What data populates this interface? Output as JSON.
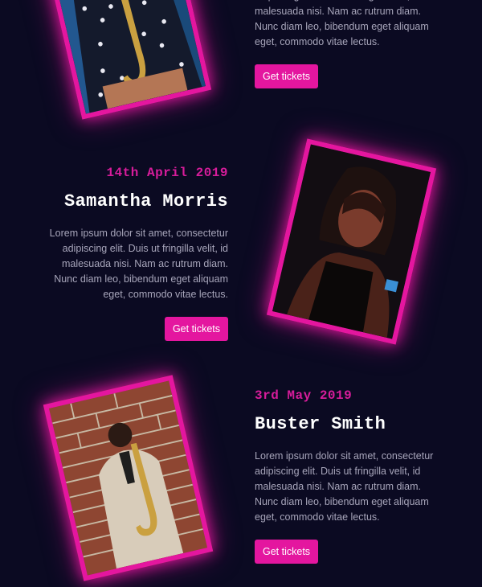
{
  "events": [
    {
      "date": "",
      "name": "",
      "description": "adipiscing elit. Duis ut fringilla velit, id malesuada nisi. Nam ac rutrum diam. Nunc diam leo, bibendum eget aliquam eget, commodo vitae lectus.",
      "button_label": "Get tickets",
      "photo_icon": "saxophone-player-photo"
    },
    {
      "date": "14th April 2019",
      "name": "Samantha Morris",
      "description": "Lorem ipsum dolor sit amet, consectetur adipiscing elit. Duis ut fringilla velit, id malesuada nisi. Nam ac rutrum diam. Nunc diam leo, bibendum eget aliquam eget, commodo vitae lectus.",
      "button_label": "Get tickets",
      "photo_icon": "singer-portrait-photo"
    },
    {
      "date": "3rd May 2019",
      "name": "Buster Smith",
      "description": "Lorem ipsum dolor sit amet, consectetur adipiscing elit. Duis ut fringilla velit, id malesuada nisi. Nam ac rutrum diam. Nunc diam leo, bibendum eget aliquam eget, commodo vitae lectus.",
      "button_label": "Get tickets",
      "photo_icon": "saxophone-player-photo"
    }
  ],
  "colors": {
    "background": "#0b0a22",
    "accent": "#e4169f",
    "date": "#d71c9b",
    "text": "#a7a5ba"
  }
}
